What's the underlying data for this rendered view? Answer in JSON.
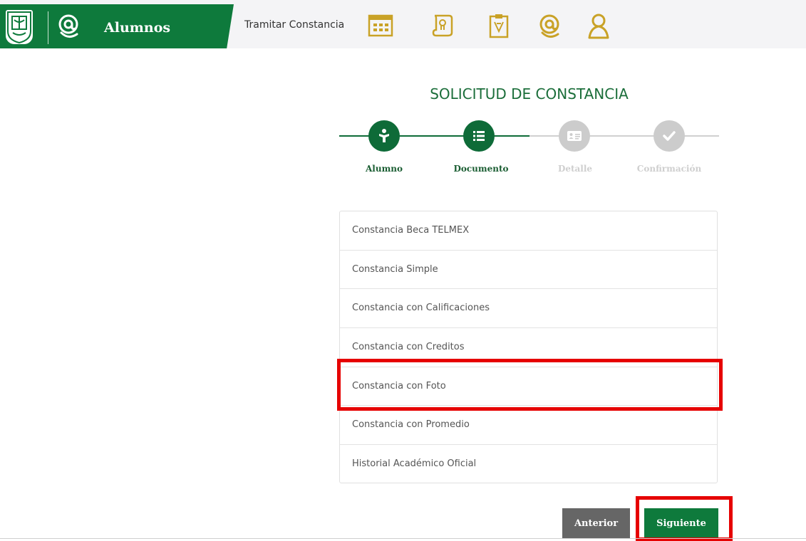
{
  "header": {
    "app_title": "Alumnos",
    "link_tramitar": "Tramitar Constancia",
    "brand_color": "#0e7a3c",
    "icon_color": "#c9a227",
    "icons": [
      "calendar-icon",
      "certificate-scroll-icon",
      "clipboard-icon",
      "at-sign-icon",
      "user-icon"
    ]
  },
  "wizard": {
    "title": "SOLICITUD DE CONSTANCIA",
    "steps": [
      {
        "label": "Alumno",
        "icon": "student-icon",
        "active": true
      },
      {
        "label": "Documento",
        "icon": "list-icon",
        "active": true
      },
      {
        "label": "Detalle",
        "icon": "id-card-icon",
        "active": false
      },
      {
        "label": "Confirmación",
        "icon": "check-icon",
        "active": false
      }
    ],
    "active_color": "#0e6b38",
    "inactive_color": "#cccccc"
  },
  "documents": {
    "items": [
      "Constancia Beca TELMEX",
      "Constancia Simple",
      "Constancia con Calificaciones",
      "Constancia con Creditos",
      "Constancia con Foto",
      "Constancia con Promedio",
      "Historial Académico Oficial"
    ],
    "highlighted": "Constancia con Foto"
  },
  "buttons": {
    "previous": "Anterior",
    "next": "Siguiente"
  },
  "highlight_color": "#e60000"
}
